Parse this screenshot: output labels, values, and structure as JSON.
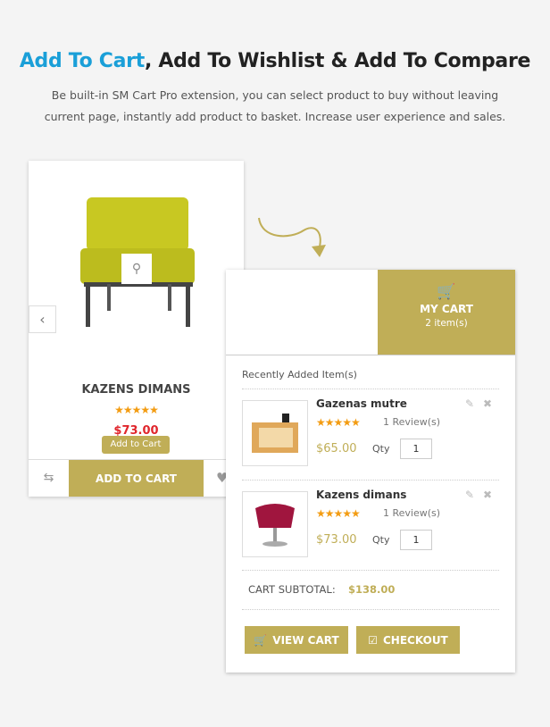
{
  "header": {
    "title_highlight": "Add To Cart",
    "title_rest": ", Add To Wishlist & Add To Compare",
    "subtitle_line1": "Be built-in SM Cart Pro extension, you can select product to buy without leaving",
    "subtitle_line2": "current page, instantly add product to basket. Increase user experience and sales."
  },
  "product_card": {
    "name": "KAZENS DIMANS",
    "rating": 4.5,
    "price": "$73.00",
    "tooltip": "Add to Cart",
    "add_to_cart_label": "ADD TO CART"
  },
  "mini_cart": {
    "title": "MY CART",
    "count": "2 item(s)",
    "recent_label": "Recently Added Item(s)",
    "items": [
      {
        "name": "Gazenas mutre",
        "rating": 4.5,
        "reviews": "1 Review(s)",
        "price": "$65.00",
        "qty_label": "Qty",
        "qty": "1"
      },
      {
        "name": "Kazens dimans",
        "rating": 4.5,
        "reviews": "1 Review(s)",
        "price": "$73.00",
        "qty_label": "Qty",
        "qty": "1"
      }
    ],
    "subtotal_label": "CART SUBTOTAL:",
    "subtotal": "$138.00",
    "view_cart_label": "VIEW CART",
    "checkout_label": "CHECKOUT"
  },
  "colors": {
    "accent": "#c0ae57",
    "title_blue": "#1a9fd8",
    "price_red": "#e0262c",
    "star": "#f39c12"
  }
}
